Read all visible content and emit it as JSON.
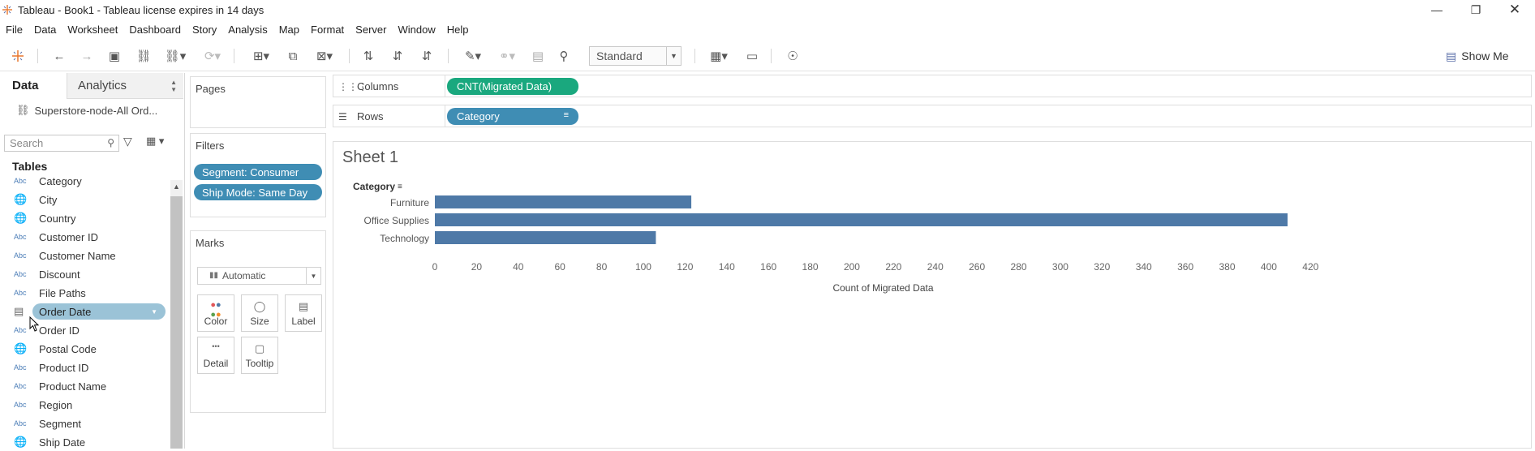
{
  "window": {
    "title": "Tableau - Book1 - Tableau license expires in 14 days",
    "controls": [
      "minimize-icon",
      "restore-icon",
      "close-icon"
    ]
  },
  "menu": [
    "File",
    "Data",
    "Worksheet",
    "Dashboard",
    "Story",
    "Analysis",
    "Map",
    "Format",
    "Server",
    "Window",
    "Help"
  ],
  "toolbar": {
    "fit_select": "Standard",
    "show_me": "Show Me"
  },
  "data_pane": {
    "tab_data": "Data",
    "tab_analytics": "Analytics",
    "datasource": "Superstore-node-All Ord...",
    "search_placeholder": "Search",
    "tables_header": "Tables",
    "fields": [
      {
        "type": "Abc",
        "name": "Category"
      },
      {
        "type": "geo",
        "name": "City"
      },
      {
        "type": "geo",
        "name": "Country"
      },
      {
        "type": "Abc",
        "name": "Customer ID"
      },
      {
        "type": "Abc",
        "name": "Customer Name"
      },
      {
        "type": "Abc",
        "name": "Discount"
      },
      {
        "type": "Abc",
        "name": "File Paths"
      },
      {
        "type": "date",
        "name": "Order Date",
        "selected": true
      },
      {
        "type": "Abc",
        "name": "Order ID"
      },
      {
        "type": "geo",
        "name": "Postal Code"
      },
      {
        "type": "Abc",
        "name": "Product ID"
      },
      {
        "type": "Abc",
        "name": "Product Name"
      },
      {
        "type": "Abc",
        "name": "Region"
      },
      {
        "type": "Abc",
        "name": "Segment"
      },
      {
        "type": "geo",
        "name": "Ship Date"
      }
    ]
  },
  "cards": {
    "pages": "Pages",
    "filters": "Filters",
    "filter_pills": [
      "Segment: Consumer",
      "Ship Mode: Same Day"
    ],
    "marks": "Marks",
    "mark_type": "Automatic",
    "mark_buttons": [
      "Color",
      "Size",
      "Label",
      "Detail",
      "Tooltip"
    ]
  },
  "shelves": {
    "columns_label": "Columns",
    "columns_pill": "CNT(Migrated Data)",
    "rows_label": "Rows",
    "rows_pill": "Category"
  },
  "sheet": {
    "title": "Sheet 1",
    "category_header": "Category"
  },
  "colors": {
    "bar": "#4e79a7",
    "green_pill": "#1aa87e",
    "blue_pill": "#3f8db4"
  },
  "chart_data": {
    "type": "bar",
    "orientation": "horizontal",
    "categories": [
      "Furniture",
      "Office Supplies",
      "Technology"
    ],
    "values": [
      123,
      409,
      106
    ],
    "xlabel": "Count of Migrated Data",
    "ylabel": "Category",
    "xlim": [
      0,
      430
    ],
    "xticks": [
      0,
      20,
      40,
      60,
      80,
      100,
      120,
      140,
      160,
      180,
      200,
      220,
      240,
      260,
      280,
      300,
      320,
      340,
      360,
      380,
      400,
      420
    ],
    "grid": false
  }
}
